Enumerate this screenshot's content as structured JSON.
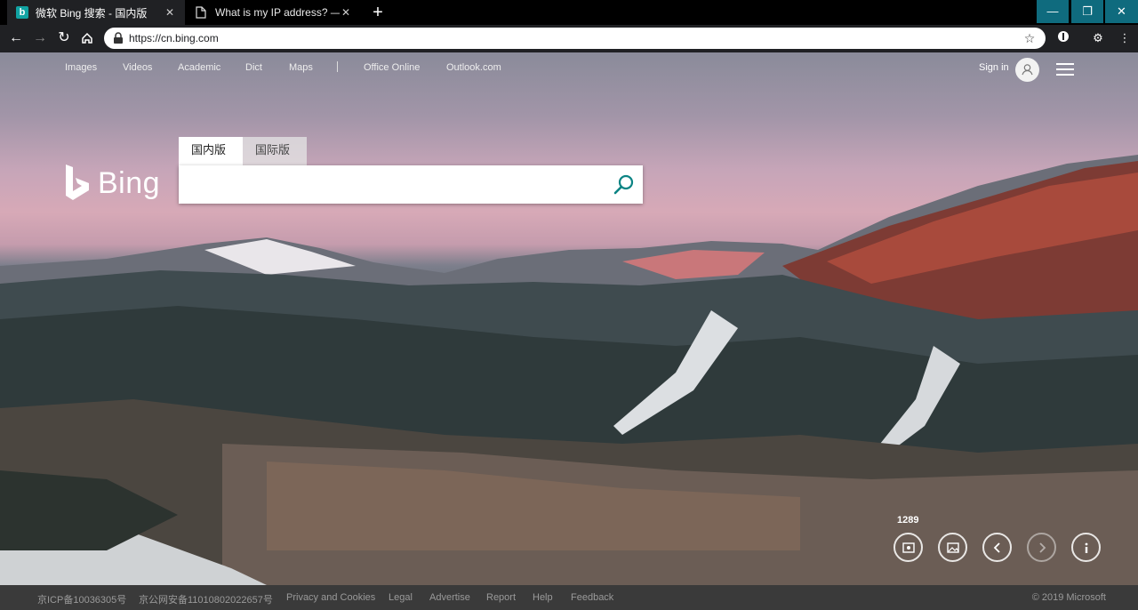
{
  "browser": {
    "tabs": [
      {
        "title": "微软 Bing 搜索 - 国内版",
        "favicon": "bing-icon",
        "active": true
      },
      {
        "title": "What is my IP address? — ifconfi",
        "favicon": "document-icon",
        "active": false
      }
    ],
    "new_tab_symbol": "+",
    "window_controls": {
      "minimize": "—",
      "maximize": "❐",
      "close": "✕"
    },
    "url": "https://cn.bing.com"
  },
  "bing": {
    "nav_links": [
      "Images",
      "Videos",
      "Academic",
      "Dict",
      "Maps",
      "Office Online",
      "Outlook.com"
    ],
    "sign_in_label": "Sign in",
    "logo_text": "Bing",
    "scope_tabs": [
      "国内版",
      "国际版"
    ],
    "search": {
      "placeholder": "",
      "value": ""
    },
    "counter": "1289",
    "controls": [
      "location-icon",
      "image-info-icon",
      "previous-icon",
      "next-icon",
      "info-icon"
    ],
    "accent_color": "#0c8484"
  },
  "footer": {
    "links": [
      "京ICP备10036305号",
      "京公网安备11010802022657号",
      "Privacy and Cookies",
      "Legal",
      "Advertise",
      "Report",
      "Help",
      "Feedback"
    ],
    "copyright": "© 2019 Microsoft"
  }
}
